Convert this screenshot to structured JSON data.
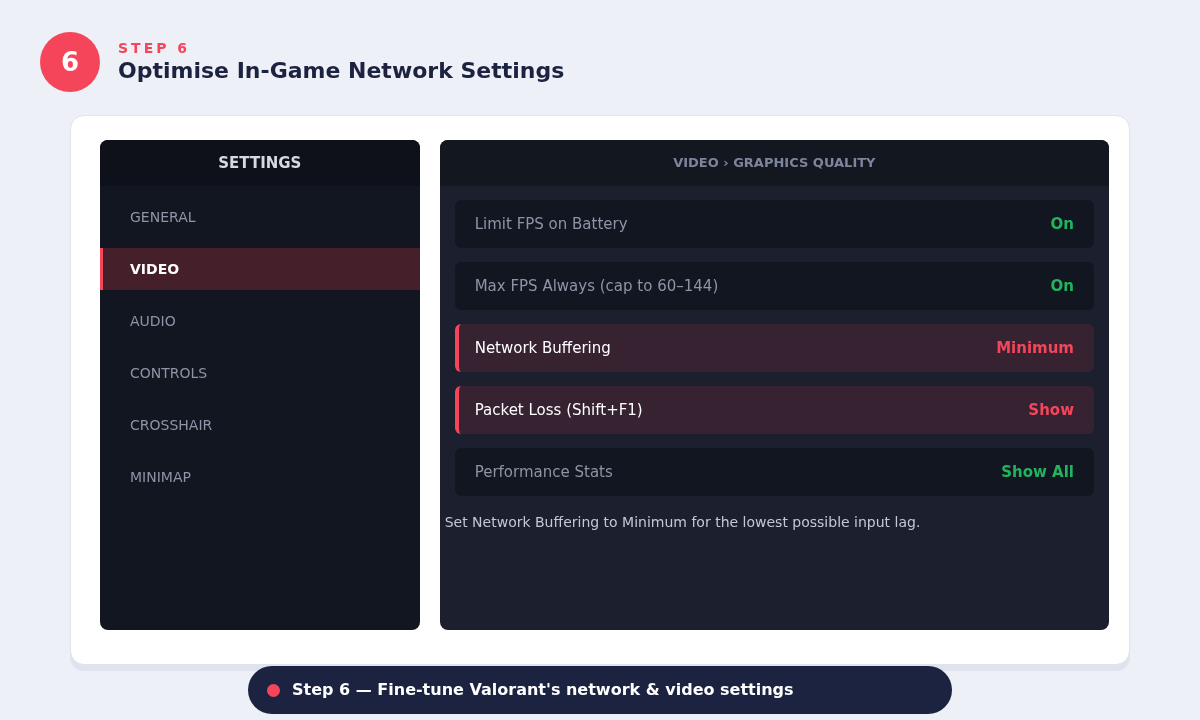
{
  "header": {
    "step_number": "6",
    "eyebrow": "STEP 6",
    "title": "Optimise In-Game Network Settings"
  },
  "sidebar": {
    "title": "SETTINGS",
    "items": [
      {
        "label": "GENERAL",
        "selected": false
      },
      {
        "label": "VIDEO",
        "selected": true
      },
      {
        "label": "AUDIO",
        "selected": false
      },
      {
        "label": "CONTROLS",
        "selected": false
      },
      {
        "label": "CROSSHAIR",
        "selected": false
      },
      {
        "label": "MINIMAP",
        "selected": false
      }
    ]
  },
  "panel": {
    "breadcrumb": "VIDEO › GRAPHICS QUALITY",
    "rows": [
      {
        "label": "Limit FPS on Battery",
        "value": "On",
        "highlighted": false
      },
      {
        "label": "Max FPS Always (cap to 60–144)",
        "value": "On",
        "highlighted": false
      },
      {
        "label": "Network Buffering",
        "value": "Minimum",
        "highlighted": true
      },
      {
        "label": "Packet Loss (Shift+F1)",
        "value": "Show",
        "highlighted": true
      },
      {
        "label": "Performance Stats",
        "value": "Show All",
        "highlighted": false
      }
    ],
    "note": "Set Network Buffering to Minimum for the lowest possible input lag."
  },
  "caption": "Step 6 — Fine-tune Valorant's network & video settings"
}
